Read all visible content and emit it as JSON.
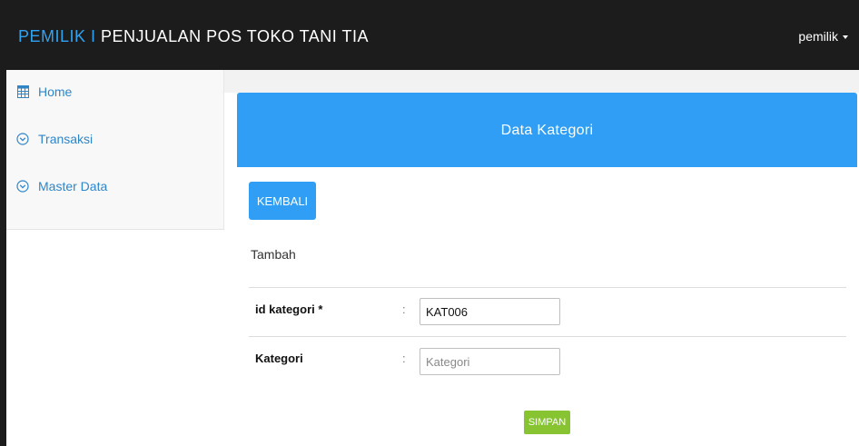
{
  "navbar": {
    "brand_role": "PEMILIK",
    "brand_separator": " I ",
    "brand_title": "PENJUALAN POS TOKO TANI TIA",
    "user_label": "pemilik"
  },
  "sidebar": {
    "items": [
      {
        "label": "Home",
        "icon": "table-icon"
      },
      {
        "label": "Transaksi",
        "icon": "chevron-circle-icon"
      },
      {
        "label": "Master Data",
        "icon": "chevron-circle-icon"
      }
    ]
  },
  "panel": {
    "title": "Data Kategori",
    "back_label": "KEMBALI",
    "section_title": "Tambah",
    "fields": [
      {
        "label": "id kategori *",
        "colon": ":",
        "value": "KAT006",
        "placeholder": ""
      },
      {
        "label": "Kategori",
        "colon": ":",
        "value": "",
        "placeholder": "Kategori"
      }
    ],
    "submit_label": "SIMPAN"
  },
  "colors": {
    "navbar_bg": "#1c1c1c",
    "accent": "#2ea3f2",
    "panel_head": "#2f9ef4",
    "submit": "#88c332",
    "link": "#2e86c9"
  }
}
